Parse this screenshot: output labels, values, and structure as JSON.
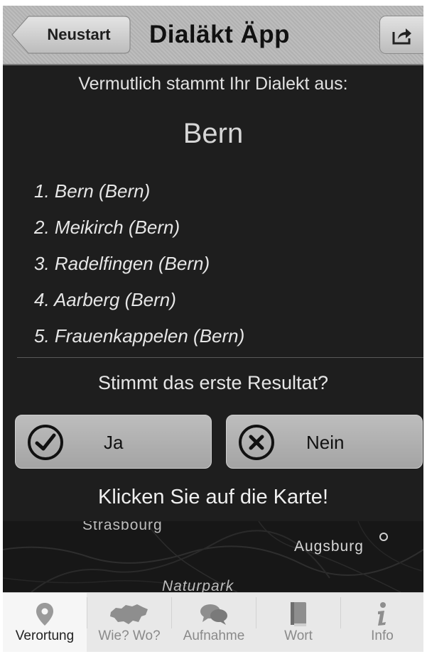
{
  "navbar": {
    "title": "Dialäkt Äpp",
    "back_label": "Neustart",
    "share_icon": "share-icon"
  },
  "main": {
    "intro": "Vermutlich stammt Ihr Dialekt aus:",
    "top_result": "Bern",
    "results": [
      "1. Bern (Bern)",
      "2. Meikirch (Bern)",
      "3. Radelfingen (Bern)",
      "4. Aarberg (Bern)",
      "5. Frauenkappelen (Bern)"
    ],
    "question": "Stimmt das erste Resultat?",
    "yes_label": "Ja",
    "no_label": "Nein",
    "hint": "Klicken Sie auf die Karte!"
  },
  "map": {
    "labels": {
      "strasbourg": "Strasbourg",
      "augsburg": "Augsburg",
      "naturpark": "Naturpark"
    }
  },
  "tabbar": {
    "active": "Verortung",
    "tabs": [
      {
        "label": "Verortung",
        "icon": "location-pin-icon"
      },
      {
        "label": "Wie? Wo?",
        "icon": "switzerland-map-icon"
      },
      {
        "label": "Aufnahme",
        "icon": "speech-bubbles-icon"
      },
      {
        "label": "Wort",
        "icon": "book-icon"
      },
      {
        "label": "Info",
        "icon": "info-icon"
      }
    ]
  },
  "colors": {
    "background": "#1e1e1e",
    "navbar": "#b8b8b8",
    "button": "#b4b4b4",
    "text": "#e6e6e6"
  }
}
